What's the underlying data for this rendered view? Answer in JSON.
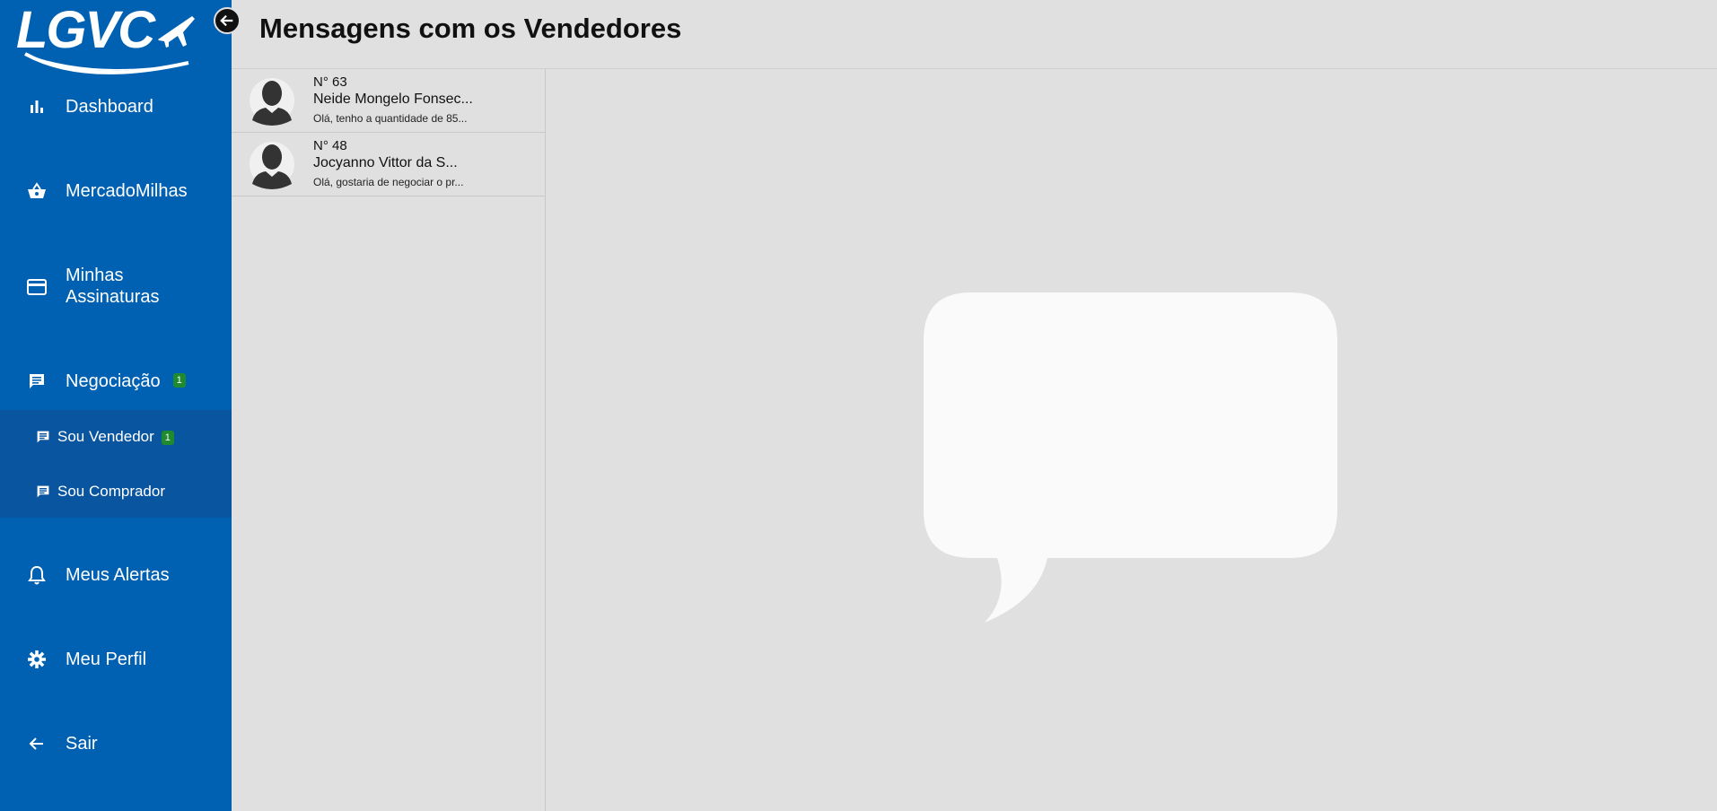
{
  "logo": {
    "text": "LGVC"
  },
  "sidebar": {
    "items": [
      {
        "label": "Dashboard",
        "icon": "bar-chart-icon"
      },
      {
        "label": "MercadoMilhas",
        "icon": "basket-icon"
      },
      {
        "label": "Minhas Assinaturas",
        "icon": "credit-card-icon"
      },
      {
        "label": "Negociação",
        "icon": "chat-icon",
        "badge": "1"
      },
      {
        "label": "Meus Alertas",
        "icon": "bell-icon"
      },
      {
        "label": "Meu Perfil",
        "icon": "gear-icon"
      },
      {
        "label": "Sair",
        "icon": "arrow-left-icon"
      }
    ],
    "submenu": [
      {
        "label": "Sou Vendedor",
        "icon": "chat-icon",
        "badge": "1"
      },
      {
        "label": "Sou Comprador",
        "icon": "chat-icon"
      }
    ]
  },
  "header": {
    "title": "Mensagens com os Vendedores"
  },
  "conversations": [
    {
      "number": "N° 63",
      "name": "Neide Mongelo Fonsec...",
      "preview": "Olá, tenho a quantidade de 85..."
    },
    {
      "number": "N° 48",
      "name": "Jocyanno Vittor da S...",
      "preview": "Olá, gostaria de negociar o pr..."
    }
  ],
  "colors": {
    "sidebar": "#0061b2",
    "submenu": "#0a55a0",
    "badge": "#1f8b2e",
    "background": "#e0e0e0"
  }
}
